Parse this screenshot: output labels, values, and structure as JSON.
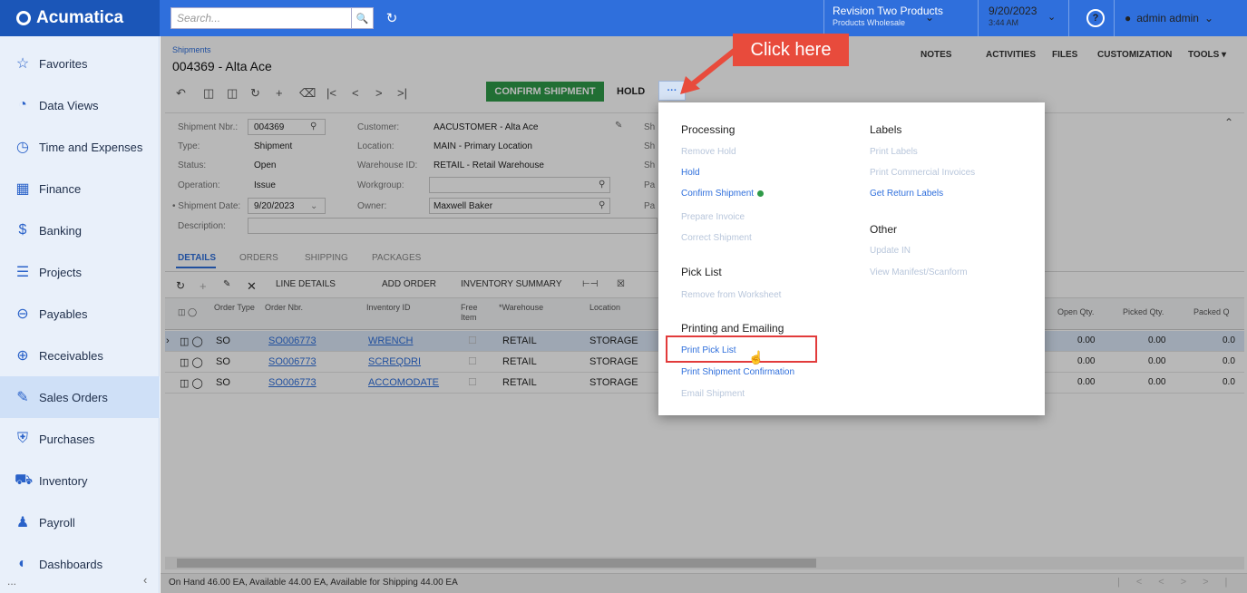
{
  "app": {
    "logo": "Acumatica"
  },
  "topbar": {
    "search_placeholder": "Search...",
    "branch": "Revision Two Products",
    "branch_sub": "Products Wholesale",
    "date": "9/20/2023",
    "time": "3:44 AM",
    "user": "admin admin"
  },
  "sidebar": {
    "items": [
      {
        "label": "Favorites",
        "icon": "star-icon"
      },
      {
        "label": "Data Views",
        "icon": "pie-chart-icon"
      },
      {
        "label": "Time and Expenses",
        "icon": "clock-icon"
      },
      {
        "label": "Finance",
        "icon": "calculator-icon"
      },
      {
        "label": "Banking",
        "icon": "dollar-icon"
      },
      {
        "label": "Projects",
        "icon": "projects-icon"
      },
      {
        "label": "Payables",
        "icon": "minus-circle-icon"
      },
      {
        "label": "Receivables",
        "icon": "plus-circle-icon"
      },
      {
        "label": "Sales Orders",
        "icon": "edit-icon"
      },
      {
        "label": "Purchases",
        "icon": "cart-icon"
      },
      {
        "label": "Inventory",
        "icon": "truck-icon"
      },
      {
        "label": "Payroll",
        "icon": "payroll-icon"
      },
      {
        "label": "Dashboards",
        "icon": "gauge-icon"
      }
    ],
    "more": "...",
    "active": "Sales Orders"
  },
  "page": {
    "breadcrumb": "Shipments",
    "title": "004369 - Alta Ace"
  },
  "toolbar": {
    "confirm": "CONFIRM SHIPMENT",
    "hold": "HOLD",
    "more": "···",
    "topnav": [
      "NOTES",
      "ACTIVITIES",
      "FILES",
      "CUSTOMIZATION",
      "TOOLS ▾"
    ]
  },
  "callout": "Click here",
  "form": {
    "shipment_nbr_label": "Shipment Nbr.:",
    "shipment_nbr": "004369",
    "type_label": "Type:",
    "type": "Shipment",
    "status_label": "Status:",
    "status": "Open",
    "operation_label": "Operation:",
    "operation": "Issue",
    "date_label": "• Shipment Date:",
    "date": "9/20/2023",
    "description_label": "Description:",
    "customer_label": "Customer:",
    "customer": "AACUSTOMER - Alta Ace",
    "location_label": "Location:",
    "location": "MAIN - Primary Location",
    "warehouse_label": "Warehouse ID:",
    "warehouse": "RETAIL - Retail Warehouse",
    "workgroup_label": "Workgroup:",
    "workgroup": "",
    "owner_label": "Owner:",
    "owner": "Maxwell Baker",
    "cut_labels": [
      "Sh",
      "Sh",
      "Sh",
      "Pa",
      "Pa"
    ]
  },
  "tabs": [
    "DETAILS",
    "ORDERS",
    "SHIPPING",
    "PACKAGES"
  ],
  "grid_toolbar": [
    "LINE DETAILS",
    "ADD ORDER",
    "INVENTORY SUMMARY"
  ],
  "grid": {
    "headers": {
      "order_type": "Order Type",
      "order_nbr": "Order Nbr.",
      "inventory": "Inventory ID",
      "free": "Free Item",
      "warehouse": "*Warehouse",
      "location": "Location",
      "open_qty": "Open Qty.",
      "picked_qty": "Picked Qty.",
      "packed_qty": "Packed Q"
    },
    "rows": [
      {
        "type": "SO",
        "nbr": "SO006773",
        "inventory": "WRENCH",
        "warehouse": "RETAIL",
        "location": "STORAGE",
        "open": "0.00",
        "picked": "0.00",
        "packed": "0.0"
      },
      {
        "type": "SO",
        "nbr": "SO006773",
        "inventory": "SCREQDRI",
        "warehouse": "RETAIL",
        "location": "STORAGE",
        "open": "0.00",
        "picked": "0.00",
        "packed": "0.0"
      },
      {
        "type": "SO",
        "nbr": "SO006773",
        "inventory": "ACCOMODATE",
        "warehouse": "RETAIL",
        "location": "STORAGE",
        "open": "0.00",
        "picked": "0.00",
        "packed": "0.0"
      }
    ]
  },
  "status_bar": "On Hand 46.00 EA, Available 44.00 EA, Available for Shipping 44.00 EA",
  "menu": {
    "processing": {
      "title": "Processing",
      "items": [
        {
          "label": "Remove Hold",
          "enabled": false
        },
        {
          "label": "Hold",
          "enabled": true
        },
        {
          "label": "Confirm Shipment",
          "enabled": true
        },
        {
          "label": "Prepare Invoice",
          "enabled": false
        },
        {
          "label": "Correct Shipment",
          "enabled": false
        }
      ]
    },
    "pick_list": {
      "title": "Pick List",
      "items": [
        {
          "label": "Remove from Worksheet",
          "enabled": false
        }
      ]
    },
    "printing": {
      "title": "Printing and Emailing",
      "items": [
        {
          "label": "Print Pick List",
          "enabled": true
        },
        {
          "label": "Print Shipment Confirmation",
          "enabled": true
        },
        {
          "label": "Email Shipment",
          "enabled": false
        }
      ]
    },
    "labels": {
      "title": "Labels",
      "items": [
        {
          "label": "Print Labels",
          "enabled": false
        },
        {
          "label": "Print Commercial Invoices",
          "enabled": false
        },
        {
          "label": "Get Return Labels",
          "enabled": true
        }
      ]
    },
    "other": {
      "title": "Other",
      "items": [
        {
          "label": "Update IN",
          "enabled": false
        },
        {
          "label": "View Manifest/Scanform",
          "enabled": false
        }
      ]
    }
  }
}
